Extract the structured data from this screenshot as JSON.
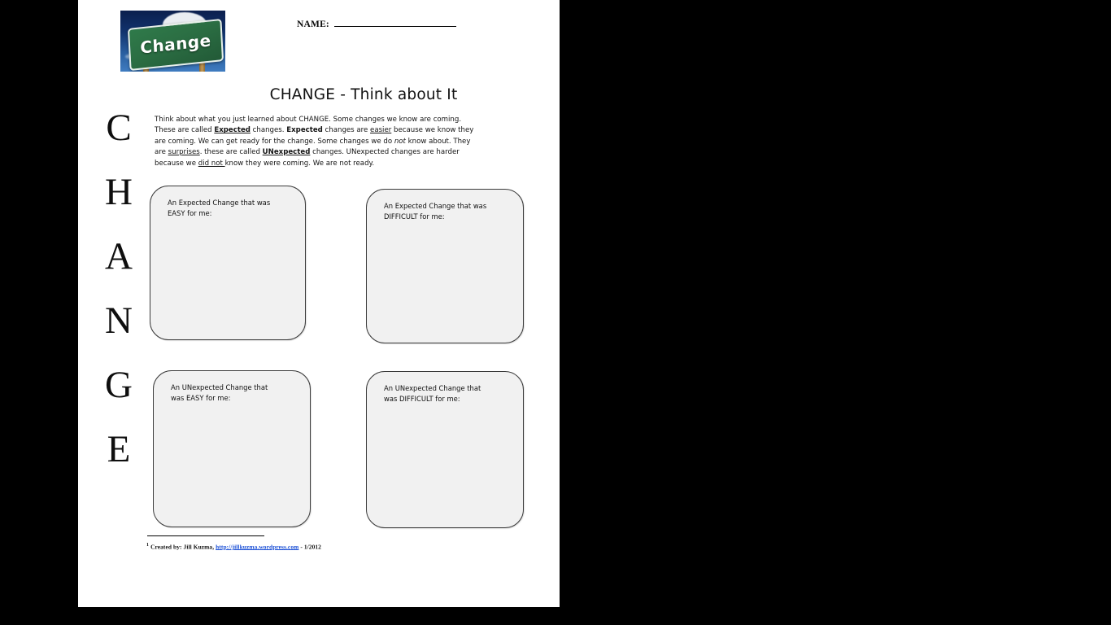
{
  "document": {
    "name_label": "NAME:",
    "title": "CHANGE - Think about It",
    "acrostic": [
      "C",
      "H",
      "A",
      "N",
      "G",
      "E"
    ],
    "sign_image": {
      "caption": "Change",
      "alt": "green road sign reading Change against blue sky with clouds"
    },
    "intro": {
      "s1": "Think about what you just learned about CHANGE. Some changes we know are coming. These are called ",
      "em1": "Expected",
      "s2": " changes. ",
      "b1": "Expected",
      "s3": " changes are ",
      "em2": "easier",
      "s4": " because we know they are coming.  We can get ready for the change. Some changes we do ",
      "it1": "not",
      "s5": " know about.  They are ",
      "em3": "surprises",
      "s6": ".  these are called ",
      "em4": "UNexpected",
      "s7": " changes. UNexpected changes are harder because we ",
      "em5": "did not ",
      "s8": "know they were coming. We are not ready."
    },
    "boxes": [
      {
        "id": "expected-easy",
        "line1": "An Expected Change that was",
        "line2": "EASY for me:"
      },
      {
        "id": "expected-difficult",
        "line1": "An Expected Change that was",
        "line2": "DIFFICULT for me:"
      },
      {
        "id": "unexpected-easy",
        "line1": "An UNexpected Change that",
        "line2": "was EASY for me:"
      },
      {
        "id": "unexpected-difficult",
        "line1": "An UNexpected Change that",
        "line2": "was DIFFICULT for me:"
      }
    ],
    "footnote": {
      "marker": "1",
      "prefix": "Created by:  Jill Kuzma, ",
      "link": "http://jillkuzma.wordpress.com",
      "suffix": " - 1/2012"
    }
  }
}
